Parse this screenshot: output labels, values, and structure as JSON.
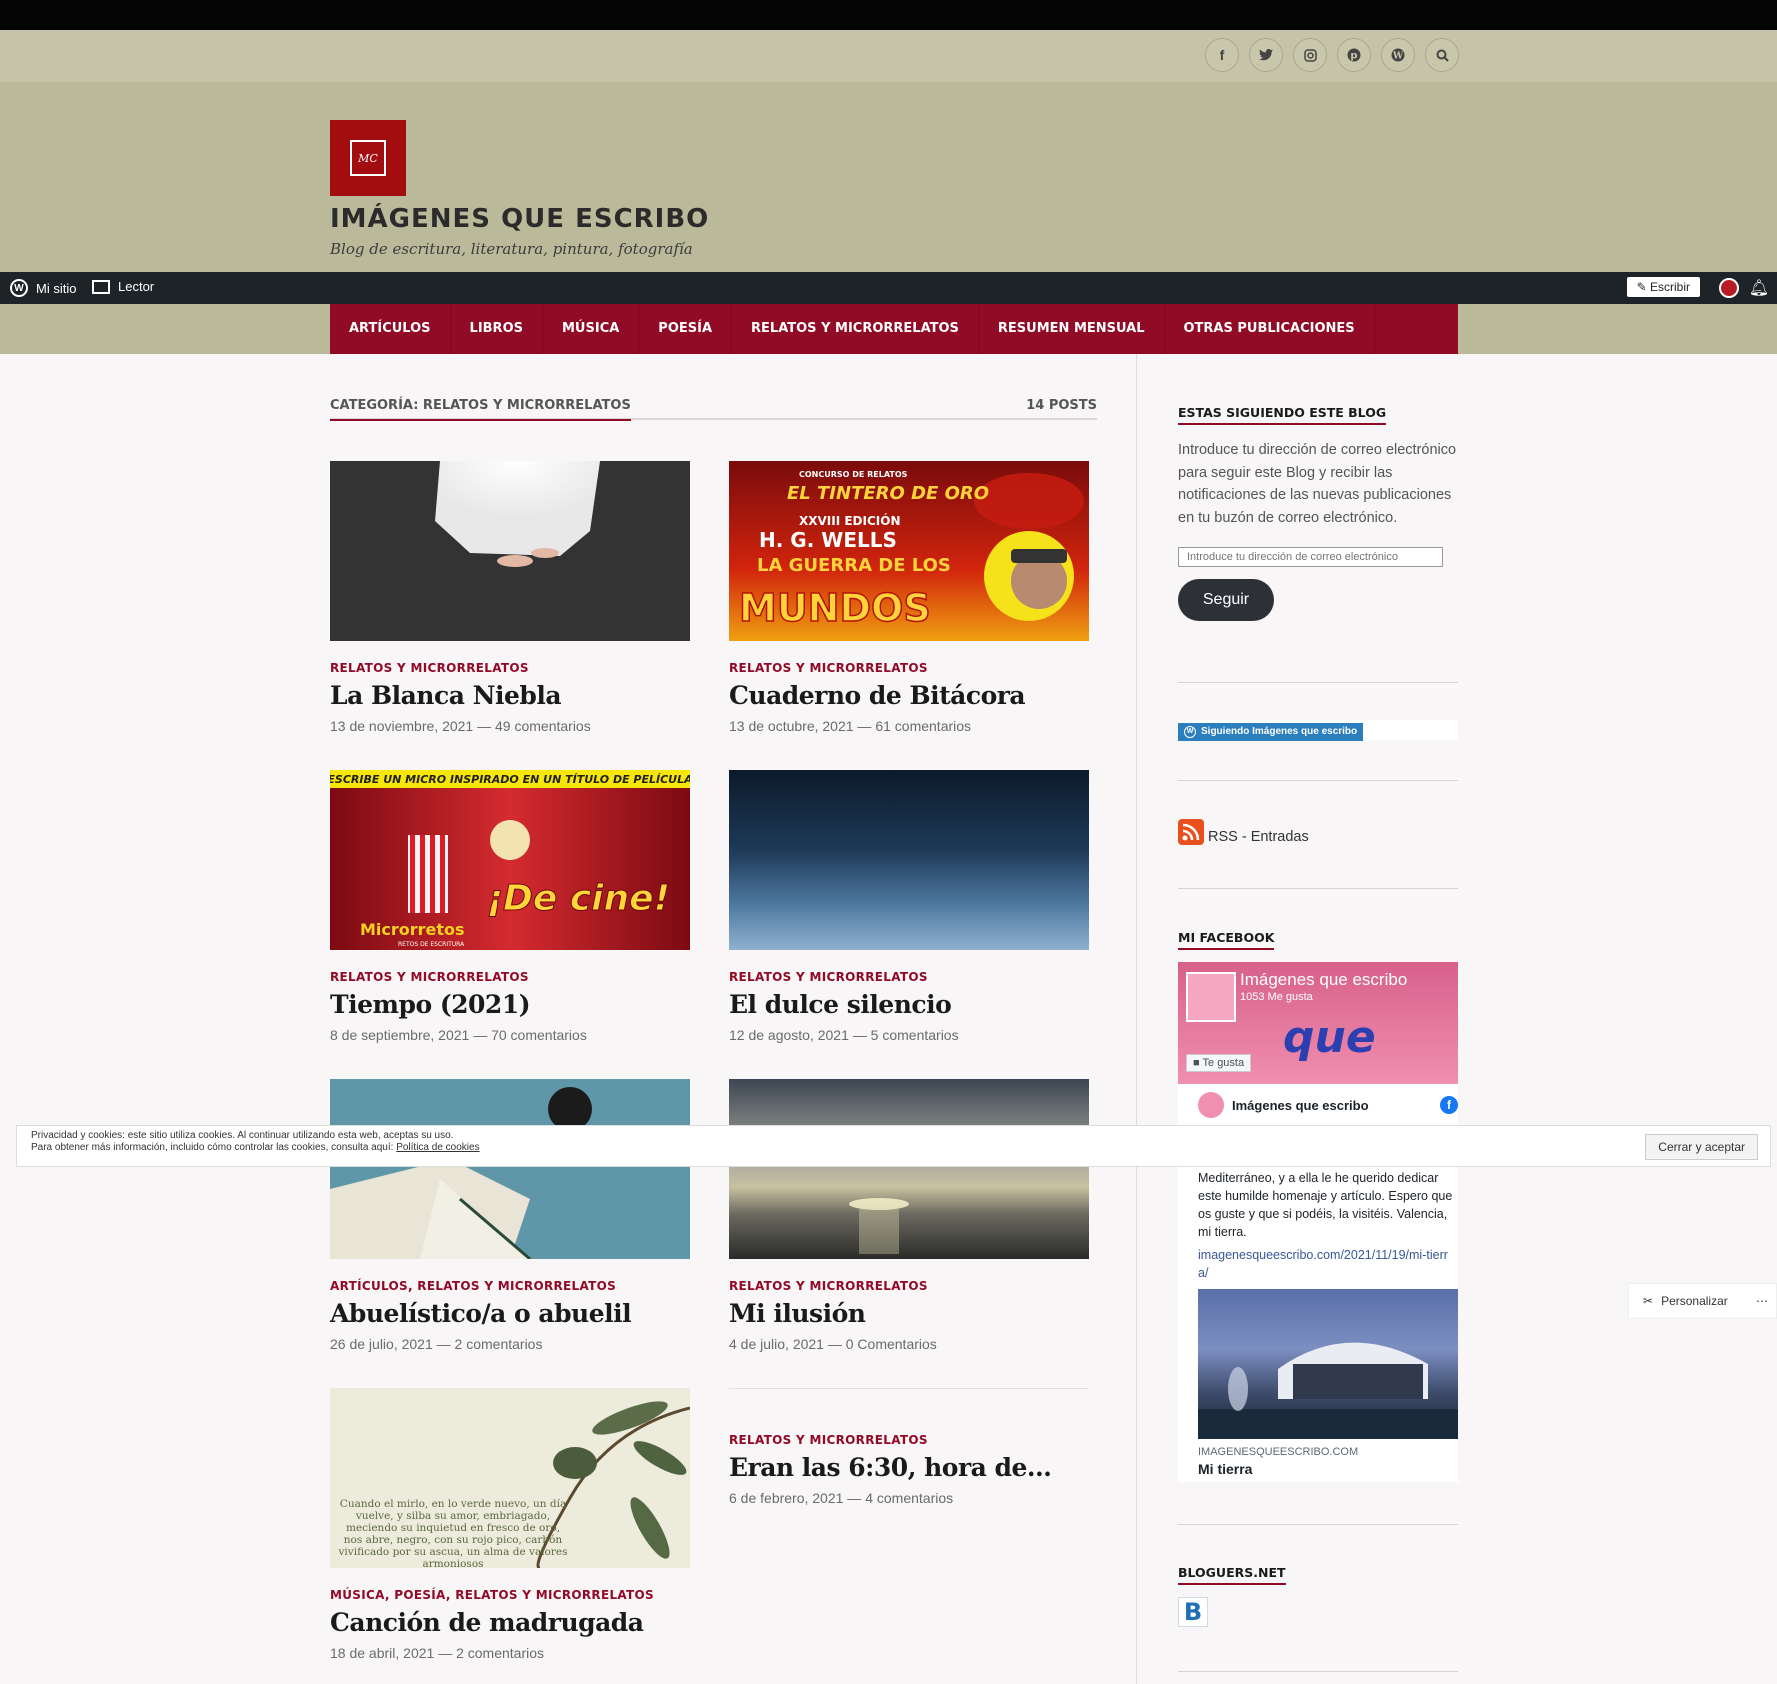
{
  "social": {
    "icons": [
      "facebook-icon",
      "twitter-icon",
      "instagram-icon",
      "pinterest-icon",
      "wordpress-icon",
      "search-icon"
    ]
  },
  "site": {
    "title": "IMÁGENES QUE ESCRIBO",
    "description": "Blog de escritura, literatura, pintura, fotografía",
    "logo_text": "MC"
  },
  "admin": {
    "my_site": "Mi sitio",
    "reader": "Lector",
    "write": "Escribir"
  },
  "nav": [
    "ARTÍCULOS",
    "LIBROS",
    "MÚSICA",
    "POESÍA",
    "RELATOS Y MICRORRELATOS",
    "RESUMEN MENSUAL",
    "OTRAS PUBLICACIONES"
  ],
  "category": {
    "label": "CATEGORÍA: RELATOS Y MICRORRELATOS",
    "count": "14 POSTS"
  },
  "posts": [
    {
      "cats": "RELATOS Y MICRORRELATOS",
      "title": "La Blanca Niebla",
      "meta": "13 de noviembre, 2021 — 49 comentarios"
    },
    {
      "cats": "RELATOS Y MICRORRELATOS",
      "title": "Cuaderno de Bitácora",
      "meta": "13 de octubre, 2021 — 61 comentarios",
      "thumb_text": {
        "l1": "CONCURSO DE RELATOS",
        "l2": "EL TINTERO DE ORO",
        "l3": "XXVIII EDICIÓN",
        "l4": "H. G. WELLS",
        "l5": "LA GUERRA DE LOS",
        "l6": "MUNDOS"
      }
    },
    {
      "cats": "RELATOS Y MICRORRELATOS",
      "title": "Tiempo (2021)",
      "meta": "8 de septiembre, 2021 — 70 comentarios",
      "thumb_text": {
        "banner": "¡ESCRIBE UN MICRO INSPIRADO EN UN TÍTULO DE PELÍCULA!",
        "big": "¡De cine!",
        "brand": "Microrretos",
        "sub": "RETOS DE ESCRITURA"
      }
    },
    {
      "cats": "RELATOS Y MICRORRELATOS",
      "title": "El dulce silencio",
      "meta": "12 de agosto, 2021 — 5 comentarios"
    },
    {
      "cats": "ARTÍCULOS, RELATOS Y MICRORRELATOS",
      "title": "Abuelístico/a o abuelil",
      "meta": "26 de julio, 2021 — 2 comentarios"
    },
    {
      "cats": "RELATOS Y MICRORRELATOS",
      "title": "Mi ilusión",
      "meta": "4 de julio, 2021 — 0 Comentarios"
    },
    {
      "cats": "MÚSICA, POESÍA, RELATOS Y MICRORRELATOS",
      "title": "Canción de madrugada",
      "meta": "18 de abril, 2021 — 2 comentarios",
      "thumb_text": {
        "poem": "Cuando el mirlo, en lo verde nuevo, un día vuelve, y silba su amor, embriagado, meciendo su inquietud en fresco de oro, nos abre, negro, con su rojo pico, carbón vivificado por su ascua, un alma de valores armoniosos"
      }
    },
    {
      "cats": "RELATOS Y MICRORRELATOS",
      "title": "Eran las 6:30, hora de…",
      "meta": "6 de febrero, 2021 — 4 comentarios"
    }
  ],
  "sidebar": {
    "follow_title": "ESTAS SIGUIENDO ESTE BLOG",
    "follow_text": "Introduce tu dirección de correo electrónico para seguir este Blog y recibir las notificaciones de las nuevas publicaciones en tu buzón de correo electrónico.",
    "email_placeholder": "Introduce tu dirección de correo electrónico",
    "follow_button": "Seguir",
    "following_badge": "Siguiendo Imágenes que escribo",
    "rss": "RSS - Entradas",
    "facebook_title": "MI FACEBOOK",
    "fb": {
      "page": "Imágenes que escribo",
      "likes": "1053 Me gusta",
      "like_btn": "Te gusta",
      "cover_text": "que",
      "post_author": "Imágenes que escribo",
      "post_text": "Mediterráneo, y a ella le he querido dedicar este humilde homenaje y artículo. Espero que os guste y que si podéis, la visitéis. Valencia, mi tierra.",
      "link": "imagenesqueescribo.com/2021/11/19/mi-tierra/",
      "domain": "IMAGENESQUEESCRIBO.COM",
      "link_title": "Mi tierra"
    },
    "bloguers_title": "BLOGUERS.NET"
  },
  "cookie": {
    "line1": "Privacidad y cookies: este sitio utiliza cookies. Al continuar utilizando esta web, aceptas su uso.",
    "line2": "Para obtener más información, incluido cómo controlar las cookies, consulta aquí:",
    "link": "Política de cookies",
    "button": "Cerrar y aceptar"
  },
  "personalizar": "Personalizar",
  "colors": {
    "accent": "#910a26",
    "header_bg": "#bab99a",
    "admin_bg": "#1d2327"
  }
}
